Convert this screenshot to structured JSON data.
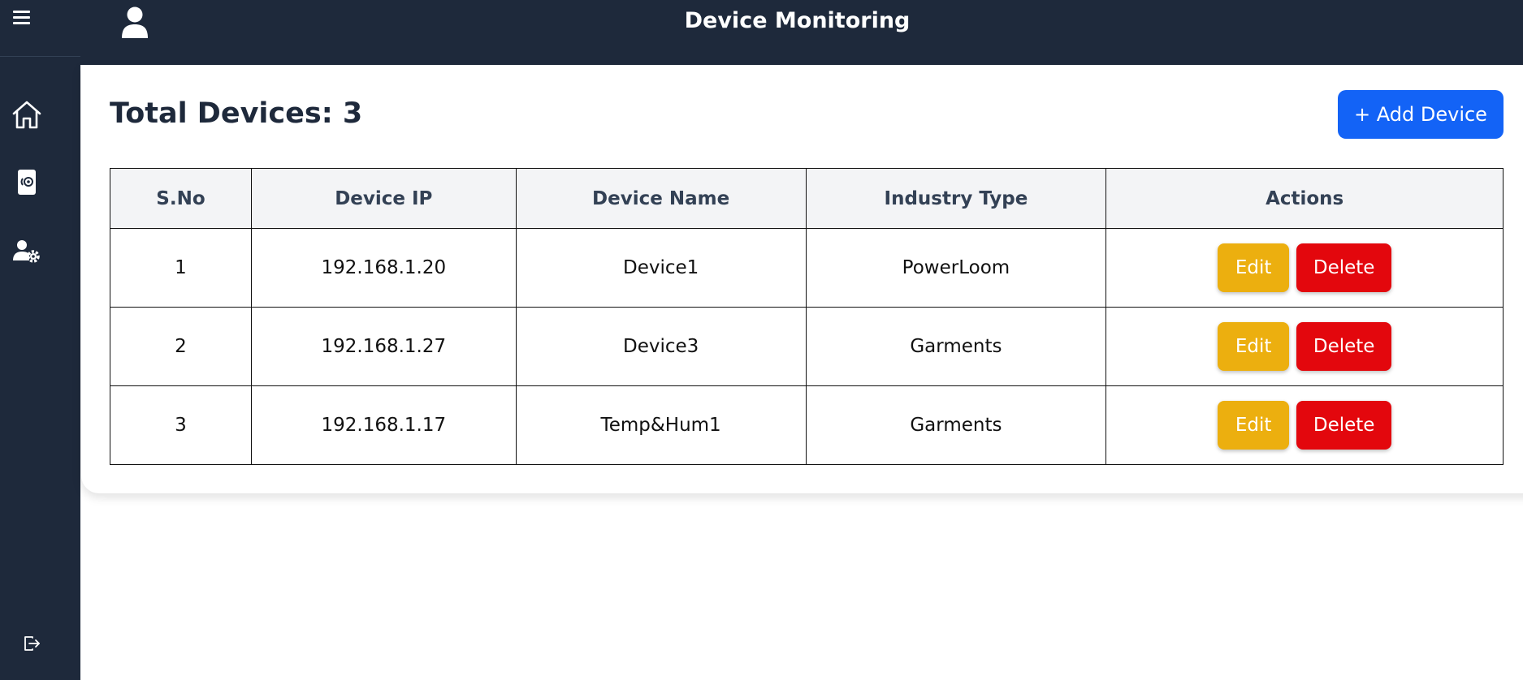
{
  "header": {
    "title": "Device Monitoring"
  },
  "sidebar": {
    "icons": [
      "menu-icon",
      "home-icon",
      "device-icon",
      "user-settings-icon",
      "logout-icon"
    ]
  },
  "main": {
    "heading": "Total Devices: 3",
    "add_button": "+ Add Device"
  },
  "table": {
    "headers": [
      "S.No",
      "Device IP",
      "Device Name",
      "Industry Type",
      "Actions"
    ],
    "rows": [
      {
        "sno": "1",
        "ip": "192.168.1.20",
        "name": "Device1",
        "industry": "PowerLoom"
      },
      {
        "sno": "2",
        "ip": "192.168.1.27",
        "name": "Device3",
        "industry": "Garments"
      },
      {
        "sno": "3",
        "ip": "192.168.1.17",
        "name": "Temp&Hum1",
        "industry": "Garments"
      }
    ],
    "edit_label": "Edit",
    "delete_label": "Delete"
  },
  "colors": {
    "sidebar_bg": "#1e293b",
    "primary": "#1363f6",
    "edit": "#ecaf0f",
    "delete": "#e3070d"
  }
}
